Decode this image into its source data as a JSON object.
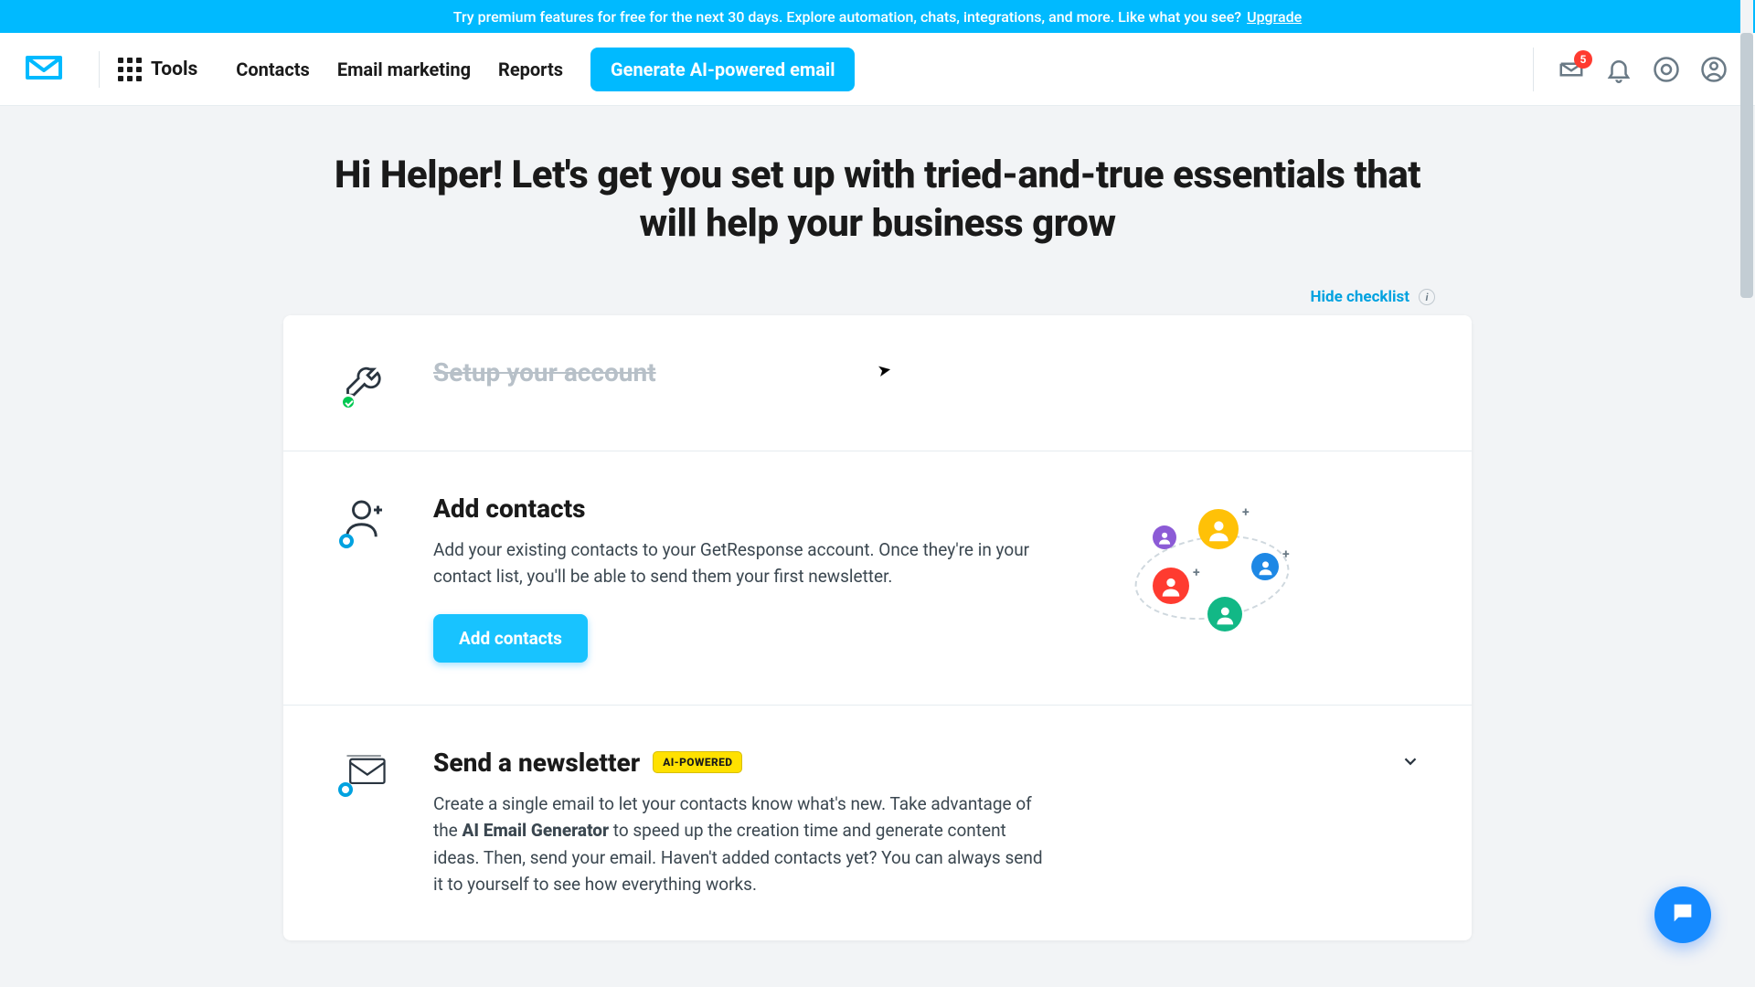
{
  "colors": {
    "accent": "#00baff",
    "cta": "#18c3ff",
    "badge_bg": "#ffe100",
    "danger": "#ff3b30"
  },
  "promo": {
    "text": "Try premium features for free for the next 30 days. Explore automation, chats, integrations, and more. Like what you see?",
    "link_label": "Upgrade"
  },
  "nav": {
    "tools_label": "Tools",
    "links": [
      "Contacts",
      "Email marketing",
      "Reports"
    ],
    "cta": "Generate AI-powered email",
    "notification_count": "5"
  },
  "hero": {
    "title": "Hi Helper! Let's get you set up with tried-and-true essentials that will help your business grow"
  },
  "checklist": {
    "hide_label": "Hide checklist",
    "steps": [
      {
        "title": "Setup your account",
        "state": "done"
      },
      {
        "title": "Add contacts",
        "desc": "Add your existing contacts to your GetResponse account. Once they're in your contact list, you'll be able to send them your first newsletter.",
        "cta": "Add contacts",
        "state": "active"
      },
      {
        "title": "Send a newsletter",
        "badge": "AI-POWERED",
        "desc_pre": "Create a single email to let your contacts know what's new. Take advantage of the ",
        "desc_bold": "AI Email Generator",
        "desc_post": " to speed up the creation time and generate content ideas. Then, send your email. Haven't added contacts yet? You can always send it to yourself to see how everything works.",
        "state": "active"
      }
    ]
  }
}
